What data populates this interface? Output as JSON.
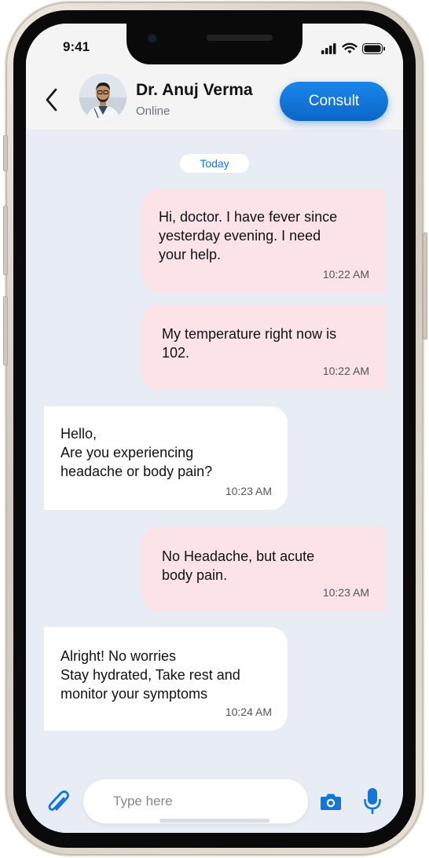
{
  "status_bar": {
    "time": "9:41"
  },
  "header": {
    "doctor_name": "Dr. Anuj Verma",
    "doctor_status": "Online",
    "consult_label": "Consult"
  },
  "chat": {
    "date_label": "Today",
    "messages": [
      {
        "direction": "outgoing",
        "text": "Hi, doctor. I have fever since\nyesterday evening. I need\nyour help.",
        "time": "10:22 AM"
      },
      {
        "direction": "outgoing",
        "text": "My temperature right now is\n102.",
        "time": "10:22 AM"
      },
      {
        "direction": "incoming",
        "text": "Hello,\nAre you experiencing\nheadache or body pain?",
        "time": "10:23 AM"
      },
      {
        "direction": "outgoing",
        "text": "No Headache, but acute\nbody pain.",
        "time": "10:23 AM"
      },
      {
        "direction": "incoming",
        "text": "Alright! No worries\nStay hydrated, Take rest and\nmonitor your symptoms",
        "time": "10:24 AM"
      }
    ]
  },
  "composer": {
    "placeholder": "Type here",
    "attach_icon": "paperclip-icon",
    "camera_icon": "camera-icon",
    "mic_icon": "microphone-icon"
  },
  "colors": {
    "accent": "#1477d8",
    "outgoing_bubble": "#fbe3e8",
    "incoming_bubble": "#ffffff",
    "chat_background": "#e8ecf4"
  }
}
